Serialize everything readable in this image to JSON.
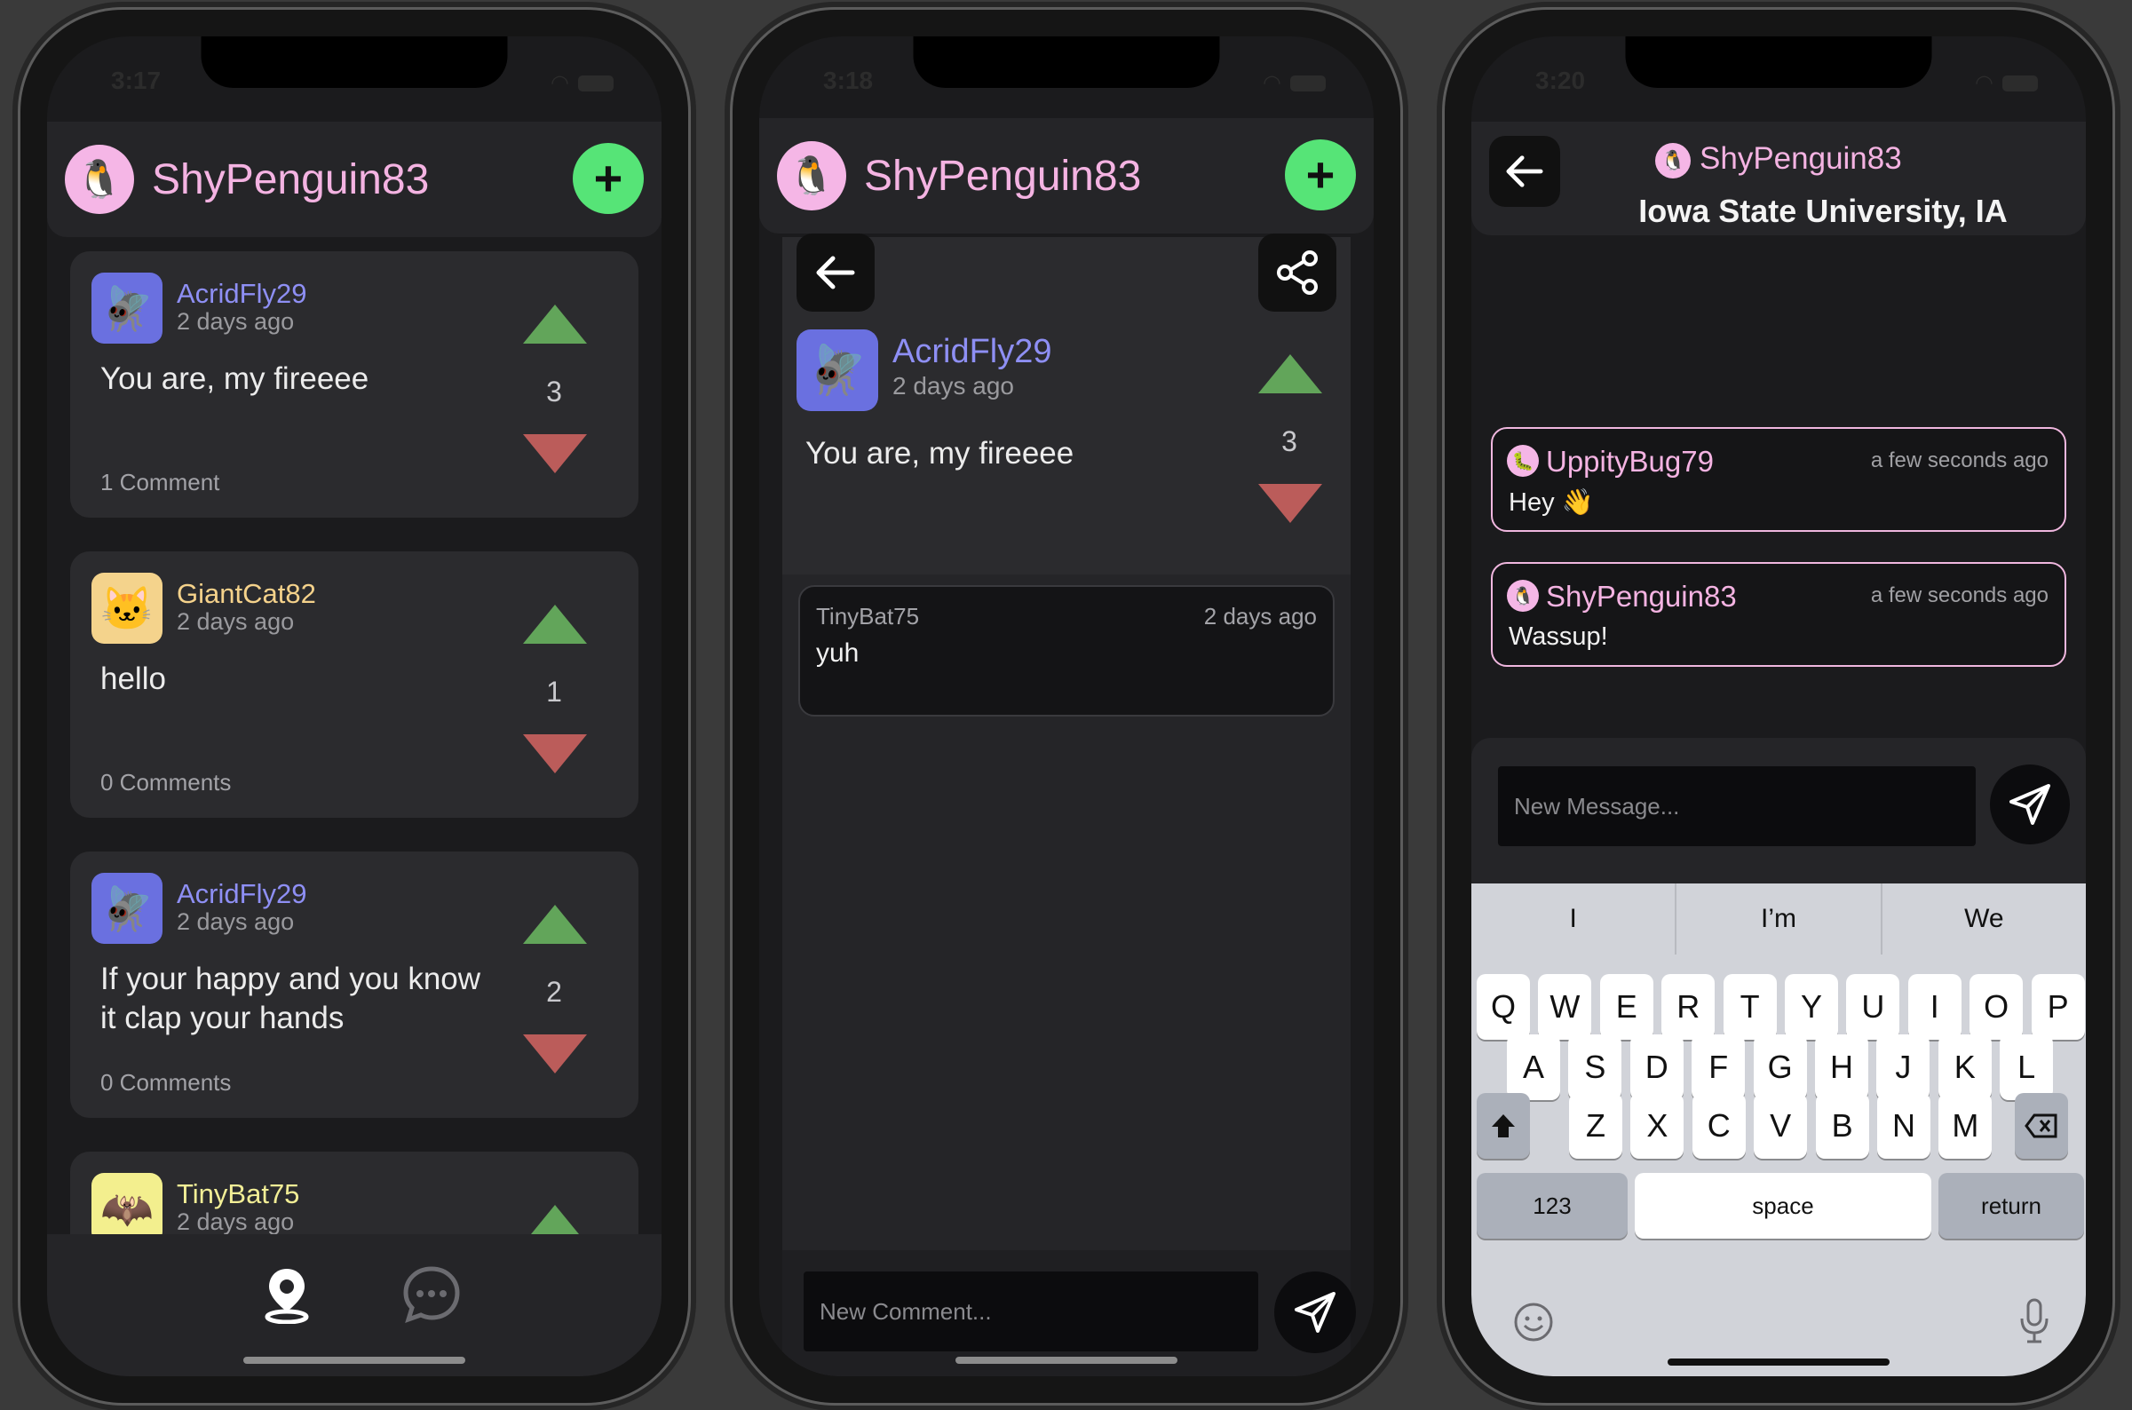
{
  "status": {
    "time1": "3:17",
    "time2": "3:18",
    "time3": "3:20"
  },
  "app": {
    "username": "ShyPenguin83",
    "add_label": "+"
  },
  "feed": {
    "posts": [
      {
        "author": "AcridFly29",
        "author_color": "#8e8ff4",
        "time": "2 days ago",
        "text": "You are, my fireeee",
        "votes": "3",
        "comments": "1 Comment",
        "avatar": "🪰",
        "avatar_bg": "#6a70e0"
      },
      {
        "author": "GiantCat82",
        "author_color": "#f5d28b",
        "time": "2 days ago",
        "text": "hello",
        "votes": "1",
        "comments": "0 Comments",
        "avatar": "🐱",
        "avatar_bg": "#f4d38c"
      },
      {
        "author": "AcridFly29",
        "author_color": "#8e8ff4",
        "time": "2 days ago",
        "text": "If your happy and you know it clap your hands",
        "votes": "2",
        "comments": "0 Comments",
        "avatar": "🪰",
        "avatar_bg": "#6a70e0"
      },
      {
        "author": "TinyBat75",
        "author_color": "#f2ee96",
        "time": "2 days ago",
        "avatar": "🦇",
        "avatar_bg": "#f3ef8e"
      }
    ]
  },
  "tabs": {
    "map": "map-pin-icon",
    "chat": "chat-bubble-icon"
  },
  "detail": {
    "author": "AcridFly29",
    "time": "2 days ago",
    "text": "You are, my fireeee",
    "votes": "3",
    "comment": {
      "author": "TinyBat75",
      "time": "2 days ago",
      "text": "yuh"
    },
    "input_placeholder": "New Comment..."
  },
  "chat": {
    "username": "ShyPenguin83",
    "title": "Iowa State University, IA",
    "messages": [
      {
        "author": "UppityBug79",
        "time": "a few seconds ago",
        "text": "Hey 👋",
        "avatar": "🐛"
      },
      {
        "author": "ShyPenguin83",
        "time": "a few seconds ago",
        "text": "Wassup!",
        "avatar": "🐧"
      }
    ],
    "input_placeholder": "New Message..."
  },
  "keyboard": {
    "suggestions": [
      "I",
      "I’m",
      "We"
    ],
    "row1": [
      "Q",
      "W",
      "E",
      "R",
      "T",
      "Y",
      "U",
      "I",
      "O",
      "P"
    ],
    "row2": [
      "A",
      "S",
      "D",
      "F",
      "G",
      "H",
      "J",
      "K",
      "L"
    ],
    "row3": [
      "Z",
      "X",
      "C",
      "V",
      "B",
      "N",
      "M"
    ],
    "numbers": "123",
    "space": "space",
    "return": "return"
  }
}
